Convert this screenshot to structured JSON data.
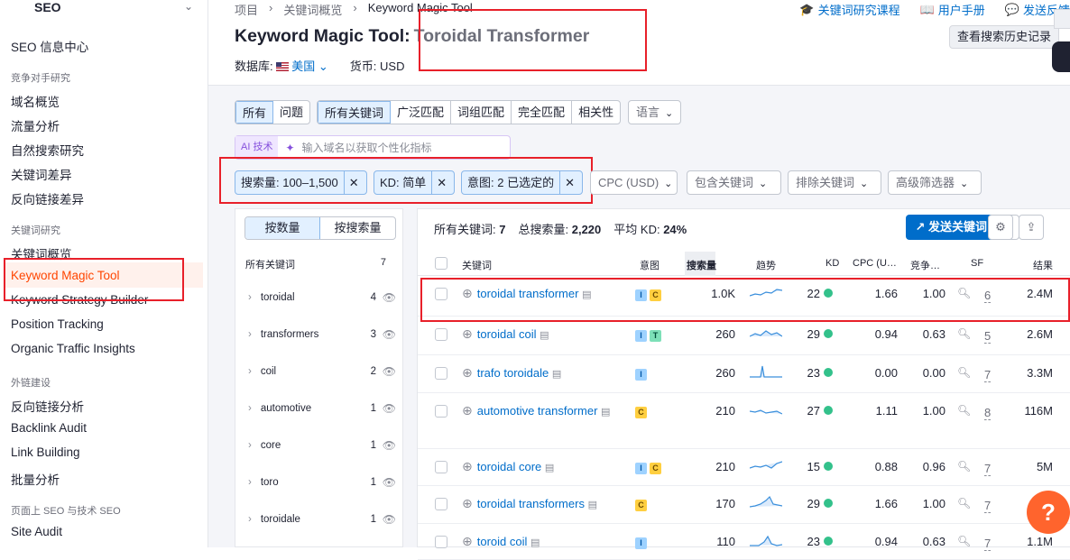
{
  "sidebar": {
    "header": "SEO",
    "sections": [
      {
        "title": "",
        "items": [
          "SEO 信息中心"
        ]
      },
      {
        "title": "竞争对手研究",
        "items": [
          "域名概览",
          "流量分析",
          "自然搜索研究",
          "关键词差异",
          "反向链接差异"
        ]
      },
      {
        "title": "关键词研究",
        "items": [
          "关键词概览",
          "Keyword Magic Tool",
          "Keyword Strategy Builder",
          "Position Tracking",
          "Organic Traffic Insights"
        ]
      },
      {
        "title": "外链建设",
        "items": [
          "反向链接分析",
          "Backlink Audit",
          "Link Building",
          "批量分析"
        ]
      },
      {
        "title": "页面上 SEO 与技术 SEO",
        "items": [
          "Site Audit"
        ]
      }
    ],
    "active": "Keyword Magic Tool"
  },
  "breadcrumb": [
    "项目",
    "关键词概览",
    "Keyword Magic Tool"
  ],
  "toplinks": [
    "关键词研究课程",
    "用户手册",
    "发送反馈"
  ],
  "page_title": "Keyword Magic Tool:",
  "keyword": "Toroidal Transformer",
  "history_button": "查看搜索历史记录",
  "meta": {
    "db_label": "数据库:",
    "db_value": "美国",
    "currency_label": "货币: USD"
  },
  "tabs1": [
    "所有",
    "问题"
  ],
  "tabs2": [
    "所有关键词",
    "广泛匹配",
    "词组匹配",
    "完全匹配",
    "相关性"
  ],
  "language": "语言",
  "ai": {
    "tag": "AI 技术",
    "placeholder": "输入域名以获取个性化指标"
  },
  "chips": [
    "搜索量: 100–1,500",
    "KD: 简单",
    "意图: 2 已选定的"
  ],
  "filters": [
    "CPC (USD)",
    "包含关键词",
    "排除关键词",
    "高级筛选器"
  ],
  "left_panel": {
    "tabs": [
      "按数量",
      "按搜索量"
    ],
    "header": "所有关键词",
    "header_count": "7",
    "groups": [
      {
        "name": "toroidal",
        "count": "4"
      },
      {
        "name": "transformers",
        "count": "3"
      },
      {
        "name": "coil",
        "count": "2"
      },
      {
        "name": "automotive",
        "count": "1"
      },
      {
        "name": "core",
        "count": "1"
      },
      {
        "name": "toro",
        "count": "1"
      },
      {
        "name": "toroidale",
        "count": "1"
      }
    ]
  },
  "summary": {
    "all_label": "所有关键词:",
    "all": "7",
    "vol_label": "总搜索量:",
    "vol": "2,220",
    "kd_label": "平均 KD:",
    "kd": "24%"
  },
  "send_button": "发送关键词",
  "columns": [
    "关键词",
    "意图",
    "搜索量",
    "趋势",
    "KD",
    "CPC (U…",
    "竞争…",
    "SF",
    "结果"
  ],
  "rows": [
    {
      "keyword": "toroidal transformer",
      "intent": [
        "I",
        "C"
      ],
      "volume": "1.0K",
      "kd": "22",
      "cpc": "1.66",
      "com": "1.00",
      "sf": "6",
      "results": "2.4M"
    },
    {
      "keyword": "toroidal coil",
      "intent": [
        "I",
        "T"
      ],
      "volume": "260",
      "kd": "29",
      "cpc": "0.94",
      "com": "0.63",
      "sf": "5",
      "results": "2.6M"
    },
    {
      "keyword": "trafo toroidale",
      "intent": [
        "I"
      ],
      "volume": "260",
      "kd": "23",
      "cpc": "0.00",
      "com": "0.00",
      "sf": "7",
      "results": "3.3M"
    },
    {
      "keyword": "automotive transformer",
      "intent": [
        "C"
      ],
      "volume": "210",
      "kd": "27",
      "cpc": "1.11",
      "com": "1.00",
      "sf": "8",
      "results": "116M"
    },
    {
      "keyword": "toroidal core",
      "intent": [
        "I",
        "C"
      ],
      "volume": "210",
      "kd": "15",
      "cpc": "0.88",
      "com": "0.96",
      "sf": "7",
      "results": "5M"
    },
    {
      "keyword": "toroidal transformers",
      "intent": [
        "C"
      ],
      "volume": "170",
      "kd": "29",
      "cpc": "1.66",
      "com": "1.00",
      "sf": "7",
      "results": ""
    },
    {
      "keyword": "toroid coil",
      "intent": [
        "I"
      ],
      "volume": "110",
      "kd": "23",
      "cpc": "0.94",
      "com": "0.63",
      "sf": "7",
      "results": "1.1M"
    }
  ],
  "help": "?"
}
